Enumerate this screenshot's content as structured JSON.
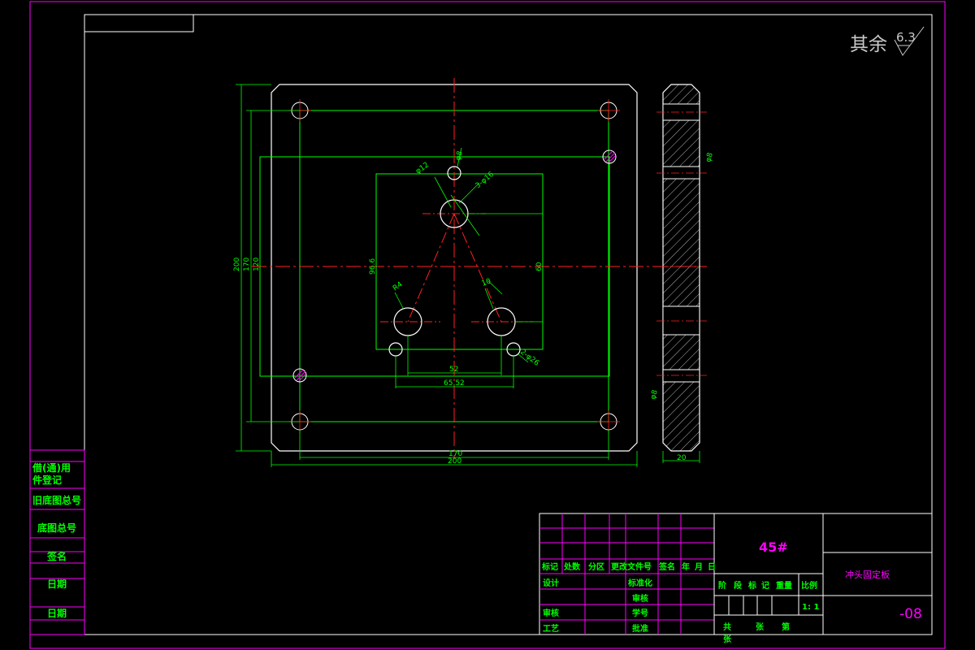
{
  "roughness": {
    "prefix": "其余",
    "value": "6.3"
  },
  "front_view": {
    "dims": {
      "d200_v": "200",
      "d170_v": "170",
      "d120_v": "120",
      "d96_6": "96.6",
      "d60": "60",
      "d52": "52",
      "d65_52": "65.52",
      "d170_h": "170",
      "d200_h": "200"
    },
    "callouts": {
      "top_small": "φ8",
      "r12": "φ12",
      "three_holes": "3-φ16",
      "r4": "R4",
      "r10": "10",
      "two_holes": "2-φ26"
    }
  },
  "side_view": {
    "thickness": "20",
    "callout_a": "φ8",
    "callout_b": "φ8"
  },
  "left_stamp": [
    "借(通)用",
    "件登记",
    "旧底图总号",
    "底图总号",
    "签名",
    "日期",
    "日期"
  ],
  "title_block": {
    "material": "45#",
    "part_name": "冲头固定板",
    "drawing_no": "-08",
    "scale": "1: 1",
    "rev_header": [
      "标记",
      "处数",
      "分区",
      "更改文件号",
      "签名",
      "年",
      "月",
      "日"
    ],
    "sign_left": [
      "设计",
      "审核",
      "工艺"
    ],
    "sign_mid": [
      "标准化",
      "审核",
      "学号",
      "批准"
    ],
    "stage_header": [
      "阶",
      "段",
      "标",
      "记",
      "重量",
      "比例"
    ],
    "sheet_row": [
      "共",
      "张",
      "第",
      "张"
    ]
  },
  "colors": {
    "border": "#ff00ff",
    "outline": "#ffffff",
    "dim": "#00ff00",
    "center": "#ff2020",
    "text_green": "#00ff00",
    "text_magenta": "#ff00ff"
  }
}
